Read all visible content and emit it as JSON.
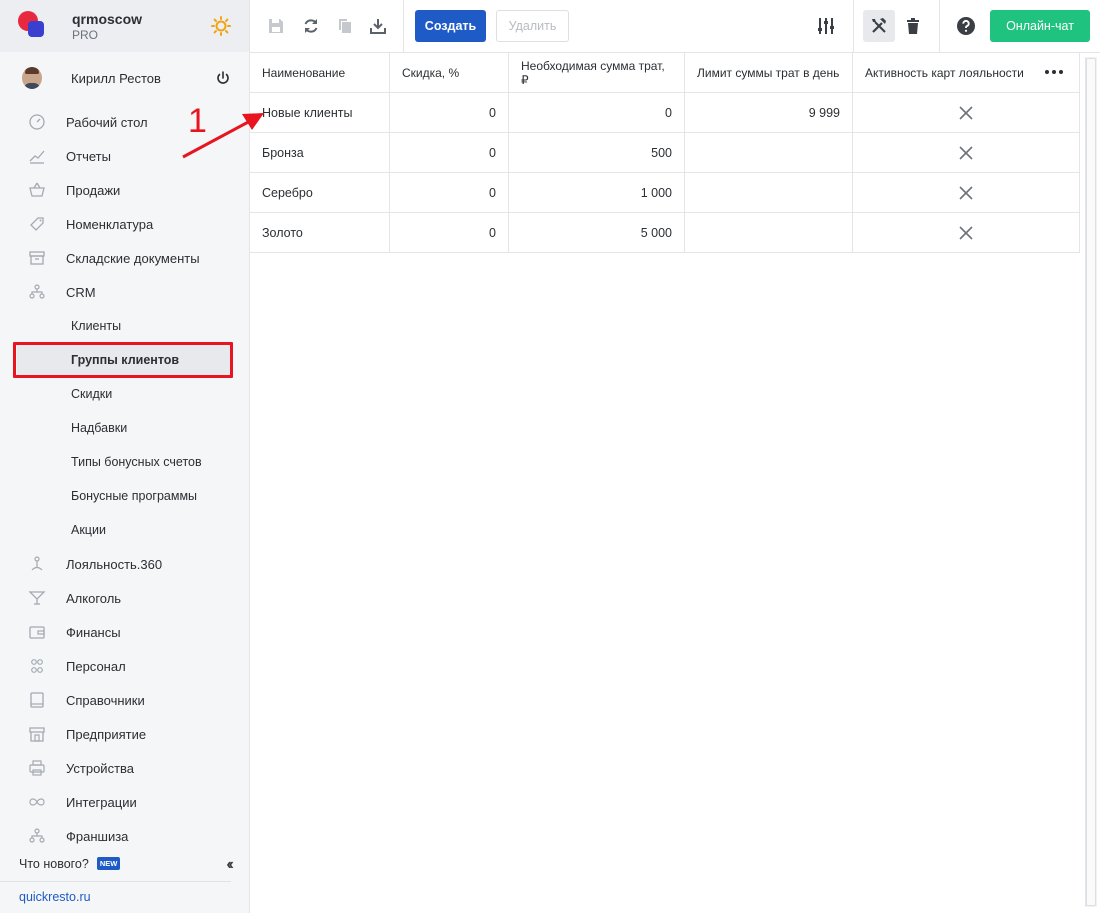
{
  "brand": {
    "name": "qrmoscow",
    "plan": "PRO"
  },
  "user": {
    "name": "Кирилл Рестов"
  },
  "nav": {
    "items": [
      {
        "label": "Рабочий стол",
        "icon": "dashboard-icon"
      },
      {
        "label": "Отчеты",
        "icon": "chart-icon"
      },
      {
        "label": "Продажи",
        "icon": "basket-icon"
      },
      {
        "label": "Номенклатура",
        "icon": "tag-icon"
      },
      {
        "label": "Складские документы",
        "icon": "archive-icon"
      },
      {
        "label": "CRM",
        "icon": "crm-icon"
      }
    ],
    "crm_sub": [
      {
        "label": "Клиенты"
      },
      {
        "label": "Группы клиентов"
      },
      {
        "label": "Скидки"
      },
      {
        "label": "Надбавки"
      },
      {
        "label": "Типы бонусных счетов"
      },
      {
        "label": "Бонусные программы"
      },
      {
        "label": "Акции"
      }
    ],
    "items2": [
      {
        "label": "Лояльность.360",
        "icon": "loyalty-icon"
      },
      {
        "label": "Алкоголь",
        "icon": "cocktail-icon"
      },
      {
        "label": "Финансы",
        "icon": "wallet-icon"
      },
      {
        "label": "Персонал",
        "icon": "people-icon"
      },
      {
        "label": "Справочники",
        "icon": "book-icon"
      },
      {
        "label": "Предприятие",
        "icon": "store-icon"
      },
      {
        "label": "Устройства",
        "icon": "printer-icon"
      },
      {
        "label": "Интеграции",
        "icon": "infinity-icon"
      },
      {
        "label": "Франшиза",
        "icon": "franchise-icon"
      }
    ]
  },
  "footer": {
    "whatsnew": "Что нового?",
    "badge": "NEW",
    "site": "quickresto.ru"
  },
  "toolbar": {
    "create": "Создать",
    "delete": "Удалить",
    "chat": "Онлайн-чат"
  },
  "table": {
    "headers": [
      "Наименование",
      "Скидка, %",
      "Необходимая сумма трат, ₽",
      "Лимит суммы трат в день",
      "Активность карт лояльности"
    ],
    "rows": [
      {
        "name": "Новые клиенты",
        "discount": "0",
        "required": "0",
        "limit": "9 999"
      },
      {
        "name": "Бронза",
        "discount": "0",
        "required": "500",
        "limit": ""
      },
      {
        "name": "Серебро",
        "discount": "0",
        "required": "1 000",
        "limit": ""
      },
      {
        "name": "Золото",
        "discount": "0",
        "required": "5 000",
        "limit": ""
      }
    ]
  },
  "annotation": {
    "number": "1"
  },
  "colors": {
    "primary": "#1f5bc6",
    "chat": "#1fc27f",
    "annotation": "#e8141f"
  }
}
